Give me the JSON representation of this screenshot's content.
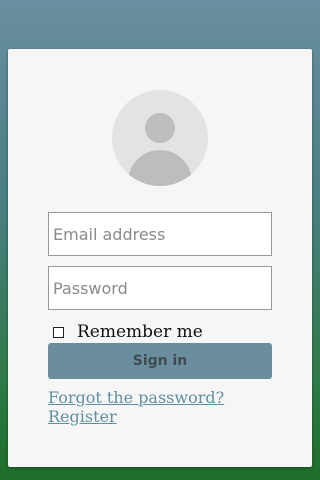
{
  "login": {
    "avatar_icon": "user-silhouette-icon",
    "email_placeholder": "Email address",
    "email_value": "",
    "password_placeholder": "Password",
    "password_value": "",
    "remember_label": "Remember me",
    "remember_checked": false,
    "signin_label": "Sign in",
    "forgot_label": "Forgot the password? ",
    "register_label": "Register"
  },
  "colors": {
    "accent": "#6b8e9e",
    "link": "#5f8fa3",
    "card": "#f6f6f6",
    "background_top": "#6a8fa0",
    "background_bottom": "#1f6d2a"
  }
}
